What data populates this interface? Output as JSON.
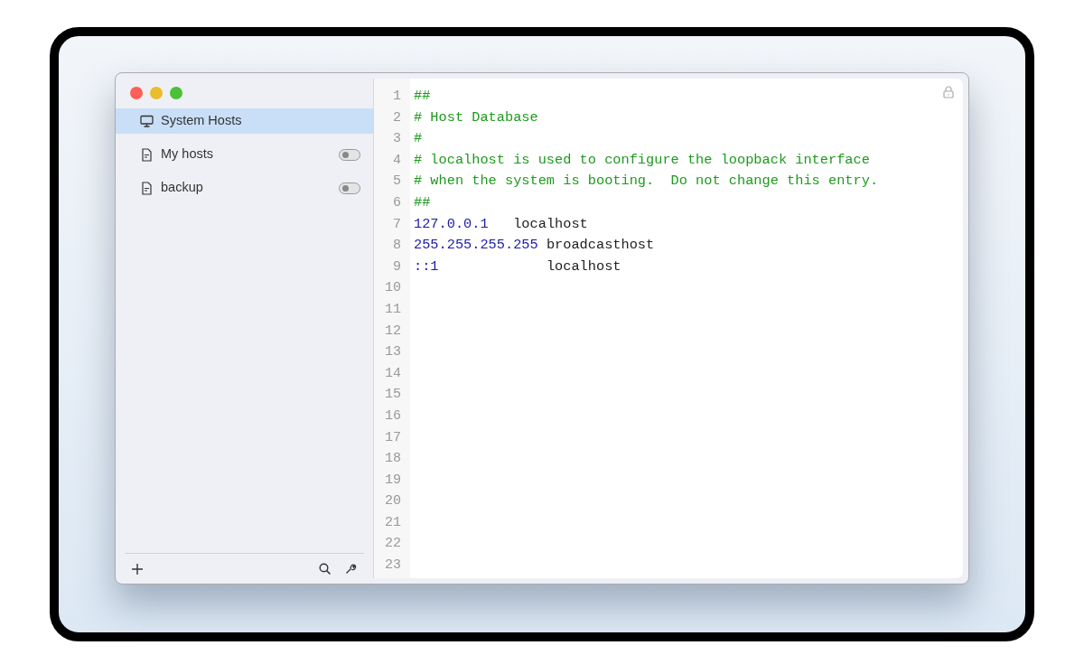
{
  "sidebar": {
    "items": [
      {
        "kind": "system",
        "label": "System Hosts",
        "selected": true
      },
      {
        "kind": "file",
        "label": "My hosts",
        "selected": false,
        "on": false
      },
      {
        "kind": "file",
        "label": "backup",
        "selected": false,
        "on": false
      }
    ]
  },
  "editor": {
    "locked": true,
    "lines": [
      {
        "number": "1",
        "tokens": [
          {
            "kind": "comment",
            "text": "##"
          }
        ]
      },
      {
        "number": "2",
        "tokens": [
          {
            "kind": "comment",
            "text": "# Host Database"
          }
        ]
      },
      {
        "number": "3",
        "tokens": [
          {
            "kind": "comment",
            "text": "#"
          }
        ]
      },
      {
        "number": "4",
        "tokens": [
          {
            "kind": "comment",
            "text": "# localhost is used to configure the loopback interface"
          }
        ]
      },
      {
        "number": "5",
        "tokens": [
          {
            "kind": "comment",
            "text": "# when the system is booting.  Do not change this entry."
          }
        ]
      },
      {
        "number": "6",
        "tokens": [
          {
            "kind": "comment",
            "text": "##"
          }
        ]
      },
      {
        "number": "7",
        "tokens": [
          {
            "kind": "ip",
            "text": "127.0.0.1"
          },
          {
            "kind": "host",
            "text": "   localhost"
          }
        ]
      },
      {
        "number": "8",
        "tokens": [
          {
            "kind": "ip",
            "text": "255.255.255.255"
          },
          {
            "kind": "host",
            "text": " broadcasthost"
          }
        ]
      },
      {
        "number": "9",
        "tokens": [
          {
            "kind": "ip",
            "text": "::1"
          },
          {
            "kind": "host",
            "text": "             localhost"
          }
        ]
      },
      {
        "number": "10"
      },
      {
        "number": "11"
      },
      {
        "number": "12"
      },
      {
        "number": "13"
      },
      {
        "number": "14"
      },
      {
        "number": "15"
      },
      {
        "number": "16"
      },
      {
        "number": "17"
      },
      {
        "number": "18"
      },
      {
        "number": "19"
      },
      {
        "number": "20"
      },
      {
        "number": "21"
      },
      {
        "number": "22"
      },
      {
        "number": "23"
      }
    ]
  }
}
